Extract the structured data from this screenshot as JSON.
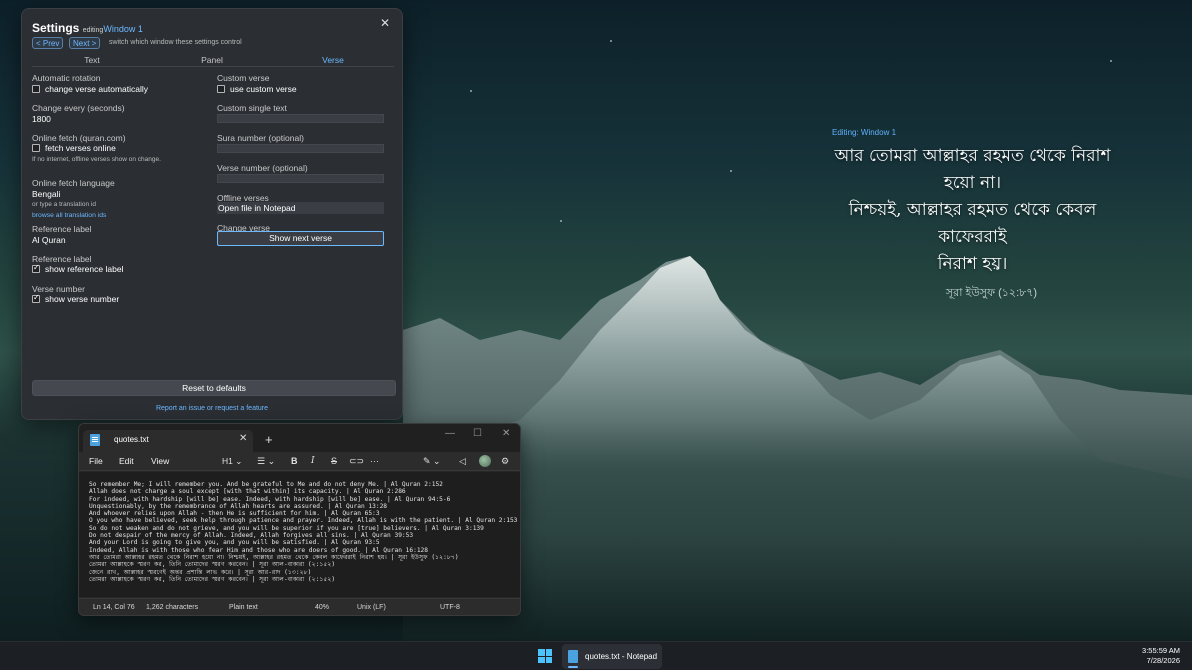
{
  "overlay": {
    "editing": "Editing: Window 1",
    "verse_lines": [
      "আর তোমরা আল্লাহর রহমত থেকে নিরাশ হয়ো না।",
      "নিশ্চয়ই, আল্লাহর রহমত থেকে কেবল কাফেররাই",
      "নিরাশ হয়।"
    ],
    "reference": "সূরা ইউসুফ (১২:৮৭)"
  },
  "settings": {
    "title": "Settings",
    "editing_prefix": "editing",
    "window_name": "Window 1",
    "prev_label": "< Prev",
    "next_label": "Next >",
    "switch_hint": "switch which window these settings control",
    "close_label": "✕",
    "tabs": [
      "Text",
      "Panel",
      "Verse"
    ],
    "active_tab": "Verse",
    "left": {
      "auto_rotation_label": "Automatic rotation",
      "auto_rotation_cb": "change verse automatically",
      "auto_rotation_checked": false,
      "change_every_label": "Change every (seconds)",
      "change_every_value": "1800",
      "online_fetch_label": "Online fetch (quran.com)",
      "online_fetch_cb": "fetch verses online",
      "online_fetch_checked": false,
      "online_fetch_hint": "If no internet, offline verses show on change.",
      "fetch_lang_label": "Online fetch language",
      "fetch_lang_value": "Bengali",
      "fetch_lang_hint": "or type a translation id",
      "browse_link": "browse all translation ids",
      "ref_label_label": "Reference label",
      "ref_label_value": "Al Quran",
      "ref_label2_label": "Reference label",
      "show_ref_cb": "show reference label",
      "show_ref_checked": true,
      "verse_number_label": "Verse number",
      "show_verse_num_cb": "show verse number",
      "show_verse_num_checked": true
    },
    "right": {
      "custom_verse_label": "Custom verse",
      "custom_verse_cb": "use custom verse",
      "custom_verse_checked": false,
      "custom_single_label": "Custom single text",
      "sura_label": "Sura number (optional)",
      "verse_num_opt_label": "Verse number (optional)",
      "offline_label": "Offline verses",
      "offline_value": "Open file in Notepad",
      "change_verse_label": "Change verse",
      "show_next_label": "Show next verse"
    },
    "reset_label": "Reset to defaults",
    "report_link": "Report an issue or request a feature"
  },
  "notepad": {
    "tab_name": "quotes.txt",
    "close_tab": "✕",
    "new_tab": "+",
    "win_minimize": "—",
    "win_maximize": "☐",
    "win_close": "✕",
    "menu": [
      "File",
      "Edit",
      "View"
    ],
    "heading_select": "H1",
    "lines": [
      "So remember Me; I will remember you. And be grateful to Me and do not deny Me. | Al Quran 2:152",
      "Allah does not charge a soul except [with that within] its capacity. | Al Quran 2:286",
      "For indeed, with hardship [will be] ease. Indeed, with hardship [will be] ease. | Al Quran 94:5-6",
      "Unquestionably, by the remembrance of Allah hearts are assured. | Al Quran 13:28",
      "And whoever relies upon Allah - then He is sufficient for him. | Al Quran 65:3",
      "O you who have believed, seek help through patience and prayer. Indeed, Allah is with the patient. | Al Quran 2:153",
      "So do not weaken and do not grieve, and you will be superior if you are [true] believers. | Al Quran 3:139",
      "Do not despair of the mercy of Allah. Indeed, Allah forgives all sins. | Al Quran 39:53",
      "And your Lord is going to give you, and you will be satisfied. | Al Quran 93:5",
      "Indeed, Allah is with those who fear Him and those who are doers of good. | Al Quran 16:128",
      "আর তোমরা আল্লাহর রহমত থেকে নিরাশ হয়ো না। নিশ্চয়ই, আল্লাহর রহমত থেকে কেবল কাফেররাই নিরাশ হয়। | সূরা ইউসুফ (১২:৮৭)",
      "তোমরা আল্লাহকে স্মরণ কর, তিনি তোমাদের স্মরণ করবেন। | সূরা আল-বাকারা (২:১৫২)",
      "জেনে রাখ, আল্লাহর স্মরণেই অন্তর প্রশান্তি লাভ করে। | সূরা আর-রাদ (১৩:২৮)",
      "তোমরা আল্লাহকে স্মরণ কর, তিনি তোমাদের স্মরণ করবেন। | সূরা আল-বাকারা (২:১৫২)"
    ],
    "status": {
      "position": "Ln 14, Col 76",
      "chars": "1,262 characters",
      "type": "Plain text",
      "zoom": "40%",
      "eol": "Unix (LF)",
      "encoding": "UTF-8"
    }
  },
  "taskbar": {
    "app_label": "quotes.txt - Notepad",
    "time": "3:55:59 AM",
    "date": "7/28/2026"
  }
}
